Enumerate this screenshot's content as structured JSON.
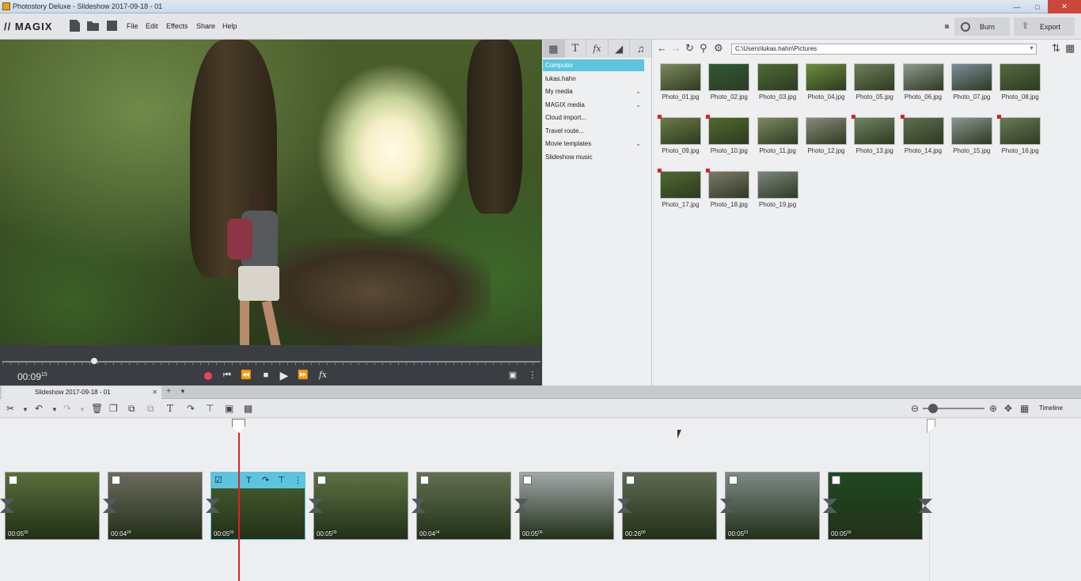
{
  "window": {
    "title": "Photostory Deluxe - Slideshow 2017-09-18 - 01"
  },
  "menubar": {
    "logo": "// MAGIX",
    "items": [
      "File",
      "Edit",
      "Effects",
      "Share",
      "Help"
    ],
    "burn_label": "Burn",
    "export_label": "Export"
  },
  "preview": {
    "timecode": "00:09",
    "timecode_frames": "15",
    "scrub_position": 0.17
  },
  "media": {
    "tabs": [
      "grid-icon",
      "text-icon",
      "fx-icon",
      "transition-icon",
      "music-icon"
    ],
    "tree": [
      {
        "label": "Computer",
        "active": true,
        "expandable": false
      },
      {
        "label": "lukas.hahn",
        "active": false,
        "expandable": false
      },
      {
        "label": "My media",
        "active": false,
        "expandable": true
      },
      {
        "label": "MAGIX media",
        "active": false,
        "expandable": true
      },
      {
        "label": "Cloud import...",
        "active": false,
        "expandable": false
      },
      {
        "label": "Travel route...",
        "active": false,
        "expandable": false
      },
      {
        "label": "Movie templates",
        "active": false,
        "expandable": true
      },
      {
        "label": "Slideshow music",
        "active": false,
        "expandable": false
      }
    ],
    "path": "C:\\Users\\lukas.hahn\\Pictures",
    "photos": [
      {
        "name": "Photo_01.jpg",
        "used": false,
        "color": "#7d8a5a"
      },
      {
        "name": "Photo_02.jpg",
        "used": false,
        "color": "#2f5a35"
      },
      {
        "name": "Photo_03.jpg",
        "used": false,
        "color": "#4e6b33"
      },
      {
        "name": "Photo_04.jpg",
        "used": false,
        "color": "#6d8d3c"
      },
      {
        "name": "Photo_05.jpg",
        "used": false,
        "color": "#6f7f5a"
      },
      {
        "name": "Photo_06.jpg",
        "used": false,
        "color": "#8e9a8c"
      },
      {
        "name": "Photo_07.jpg",
        "used": false,
        "color": "#7a8d9a"
      },
      {
        "name": "Photo_08.jpg",
        "used": false,
        "color": "#556b40"
      },
      {
        "name": "Photo_09.jpg",
        "used": true,
        "color": "#6b7b45"
      },
      {
        "name": "Photo_10.jpg",
        "used": true,
        "color": "#4f6a2c"
      },
      {
        "name": "Photo_11.jpg",
        "used": false,
        "color": "#7b8a60"
      },
      {
        "name": "Photo_12.jpg",
        "used": false,
        "color": "#8a8a7a"
      },
      {
        "name": "Photo_13.jpg",
        "used": true,
        "color": "#6f8560"
      },
      {
        "name": "Photo_14.jpg",
        "used": true,
        "color": "#5f6f4f"
      },
      {
        "name": "Photo_15.jpg",
        "used": false,
        "color": "#8a9590"
      },
      {
        "name": "Photo_16.jpg",
        "used": true,
        "color": "#6a7a55"
      },
      {
        "name": "Photo_17.jpg",
        "used": true,
        "color": "#4e6a30"
      },
      {
        "name": "Photo_18.jpg",
        "used": true,
        "color": "#80786a"
      },
      {
        "name": "Photo_19.jpg",
        "used": false,
        "color": "#7c8680"
      }
    ]
  },
  "timeline": {
    "tab_label": "Slideshow 2017-09-18 - 01",
    "mode_label": "Timeline",
    "zoom_level": 0.17,
    "clips": [
      {
        "duration": "00:05",
        "frames": "00",
        "color": "#5a6e3a",
        "selected": false
      },
      {
        "duration": "00:04",
        "frames": "24",
        "color": "#6d6a5e",
        "selected": false
      },
      {
        "duration": "00:05",
        "frames": "00",
        "color": "#4c6231",
        "selected": true
      },
      {
        "duration": "00:05",
        "frames": "00",
        "color": "#5c7242",
        "selected": false
      },
      {
        "duration": "00:04",
        "frames": "24",
        "color": "#627050",
        "selected": false
      },
      {
        "duration": "00:05",
        "frames": "00",
        "color": "#a0a8a8",
        "selected": false
      },
      {
        "duration": "00:26",
        "frames": "00",
        "color": "#5e6a50",
        "selected": false
      },
      {
        "duration": "00:05",
        "frames": "01",
        "color": "#7d8a86",
        "selected": false
      },
      {
        "duration": "00:05",
        "frames": "00",
        "color": "#1f4a22",
        "selected": false
      }
    ]
  }
}
